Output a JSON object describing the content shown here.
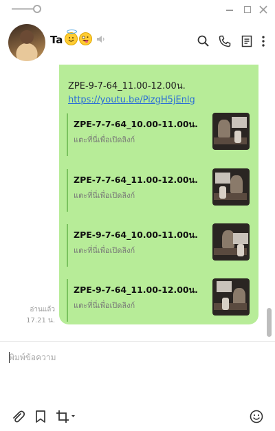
{
  "window": {
    "minimize_label": "—",
    "maximize_label": "□",
    "close_label": "✕"
  },
  "header": {
    "contact_name": "Ta",
    "emoji_1": "😇",
    "emoji_2": "🤪"
  },
  "chat": {
    "read_status": "อ่านแล้ว",
    "time": "17.21 น.",
    "message_text": "ZPE-9-7-64_11.00-12.00น.",
    "message_link": "https://youtu.be/PizgH5jEnlg",
    "previews": [
      {
        "title": "ZPE-7-7-64_10.00-11.00น.",
        "subtitle": "แตะที่นี่เพื่อเปิดลิงก์"
      },
      {
        "title": "ZPE-7-7-64_11.00-12.00น.",
        "subtitle": "แตะที่นี่เพื่อเปิดลิงก์"
      },
      {
        "title": "ZPE-9-7-64_10.00-11.00น.",
        "subtitle": "แตะที่นี่เพื่อเปิดลิงก์"
      },
      {
        "title": "ZPE-9-7-64_11.00-12.00น.",
        "subtitle": "แตะที่นี่เพื่อเปิดลิงก์"
      }
    ]
  },
  "input": {
    "placeholder": "พิมพ์ข้อความ",
    "value": ""
  },
  "colors": {
    "bubble": "#b7ec98",
    "link": "#2a6ed6",
    "preview_bar": "#7ac25e"
  }
}
